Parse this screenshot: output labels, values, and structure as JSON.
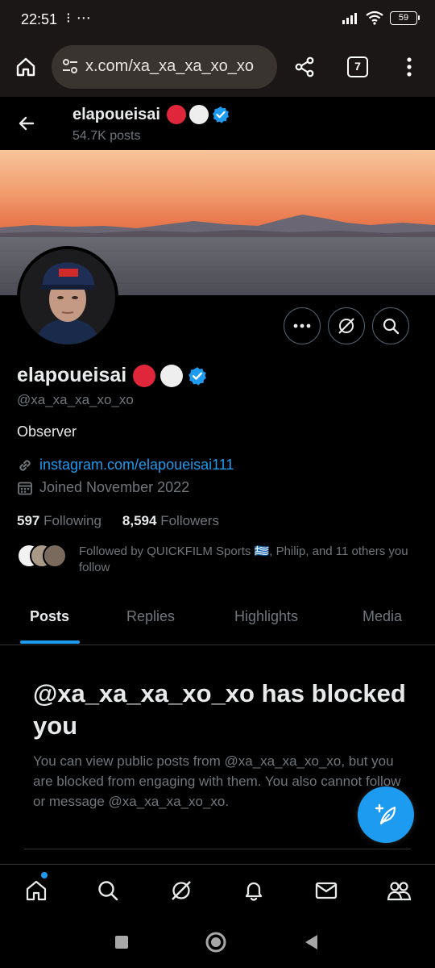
{
  "status_bar": {
    "time": "22:51",
    "extra": "⁝ ⋯",
    "battery": "59"
  },
  "browser": {
    "url": "x.com/xa_xa_xa_xo_xo",
    "tab_count": "7"
  },
  "header": {
    "name": "elapoueisai",
    "posts": "54.7K posts"
  },
  "profile": {
    "name": "elapoueisai",
    "handle": "@xa_xa_xa_xo_xo",
    "bio": "Observer",
    "link": "instagram.com/elapoueisai111",
    "joined": "Joined November 2022",
    "following_count": "597",
    "following_label": "Following",
    "followers_count": "8,594",
    "followers_label": "Followers",
    "followed_by": "Followed by QUICKFILM Sports 🇬🇷, Philip, and 11 others you follow"
  },
  "tabs": [
    "Posts",
    "Replies",
    "Highlights",
    "Media"
  ],
  "blocked": {
    "title": "@xa_xa_xa_xo_xo has blocked you",
    "text": "You can view public posts from @xa_xa_xa_xo_xo, but you are blocked from engaging with them. You also cannot follow or message @xa_xa_xa_xo_xo."
  },
  "colors": {
    "accent": "#1d9bf0",
    "red_dot": "#e0263a",
    "white_dot": "#eeeeee",
    "muted": "#71767b"
  },
  "icons": [
    "home-icon",
    "tune-icon",
    "share-icon",
    "more-vertical-icon",
    "back-arrow-icon",
    "verified-icon",
    "more-icon",
    "grok-icon",
    "search-icon",
    "link-icon",
    "calendar-icon",
    "compose-icon",
    "bell-icon",
    "mail-icon",
    "people-icon",
    "square-icon",
    "circle-icon",
    "triangle-back-icon"
  ]
}
